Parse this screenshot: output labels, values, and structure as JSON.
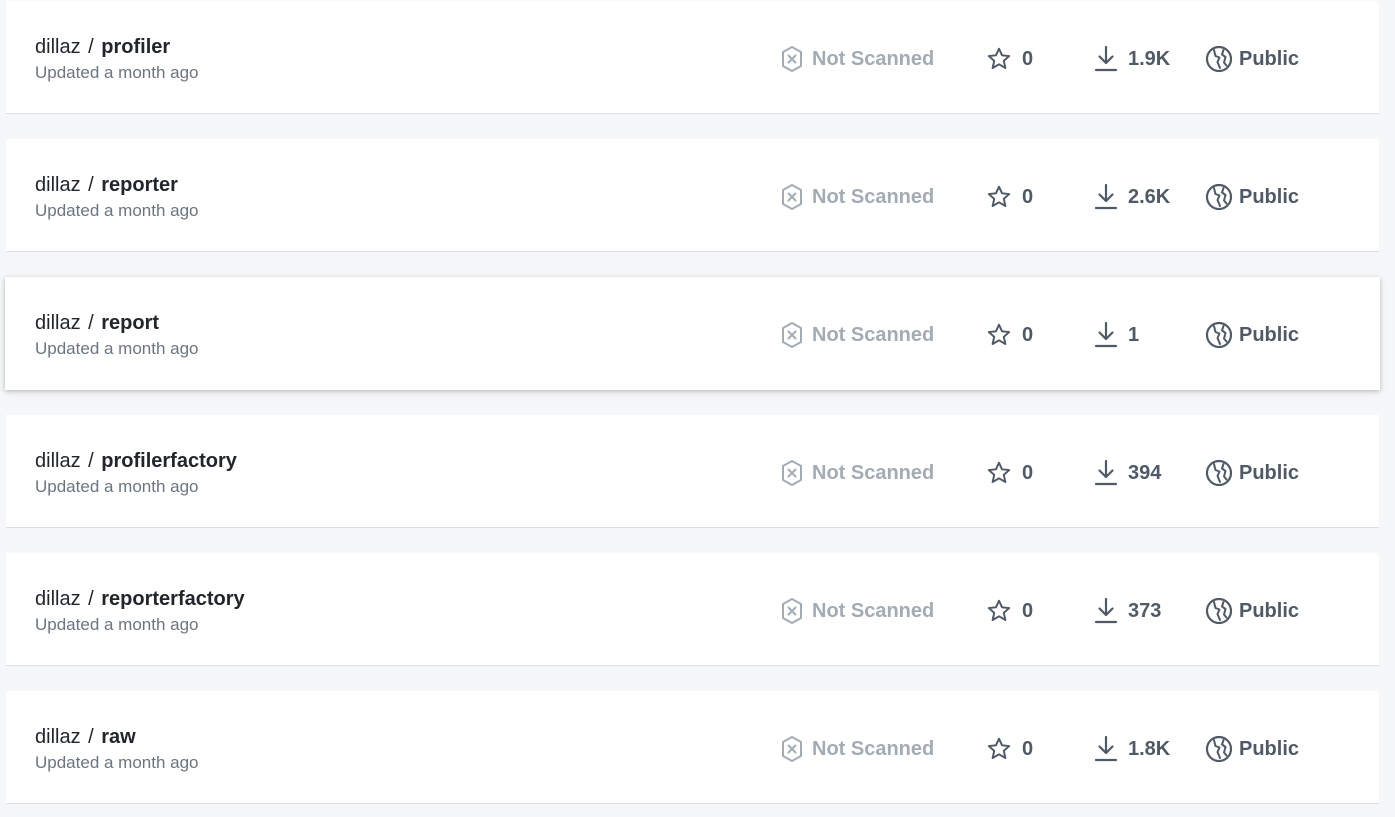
{
  "repositories": [
    {
      "owner": "dillaz",
      "separator": "/",
      "name": "profiler",
      "updated": "Updated a month ago",
      "scan_status": "Not Scanned",
      "stars": "0",
      "downloads": "1.9K",
      "visibility": "Public"
    },
    {
      "owner": "dillaz",
      "separator": "/",
      "name": "reporter",
      "updated": "Updated a month ago",
      "scan_status": "Not Scanned",
      "stars": "0",
      "downloads": "2.6K",
      "visibility": "Public"
    },
    {
      "owner": "dillaz",
      "separator": "/",
      "name": "report",
      "updated": "Updated a month ago",
      "scan_status": "Not Scanned",
      "stars": "0",
      "downloads": "1",
      "visibility": "Public"
    },
    {
      "owner": "dillaz",
      "separator": "/",
      "name": "profilerfactory",
      "updated": "Updated a month ago",
      "scan_status": "Not Scanned",
      "stars": "0",
      "downloads": "394",
      "visibility": "Public"
    },
    {
      "owner": "dillaz",
      "separator": "/",
      "name": "reporterfactory",
      "updated": "Updated a month ago",
      "scan_status": "Not Scanned",
      "stars": "0",
      "downloads": "373",
      "visibility": "Public"
    },
    {
      "owner": "dillaz",
      "separator": "/",
      "name": "raw",
      "updated": "Updated a month ago",
      "scan_status": "Not Scanned",
      "stars": "0",
      "downloads": "1.8K",
      "visibility": "Public"
    }
  ],
  "icons": {
    "scan": "shield-x-icon",
    "stars": "star-icon",
    "downloads": "download-icon",
    "visibility": "globe-icon"
  },
  "colors": {
    "page_background": "#f6f7f9",
    "card_background": "#ffffff",
    "title_text": "#21262b",
    "muted_text": "#6b7580",
    "scan_status_text": "#a3acb5",
    "metric_text": "#4f5a66"
  }
}
